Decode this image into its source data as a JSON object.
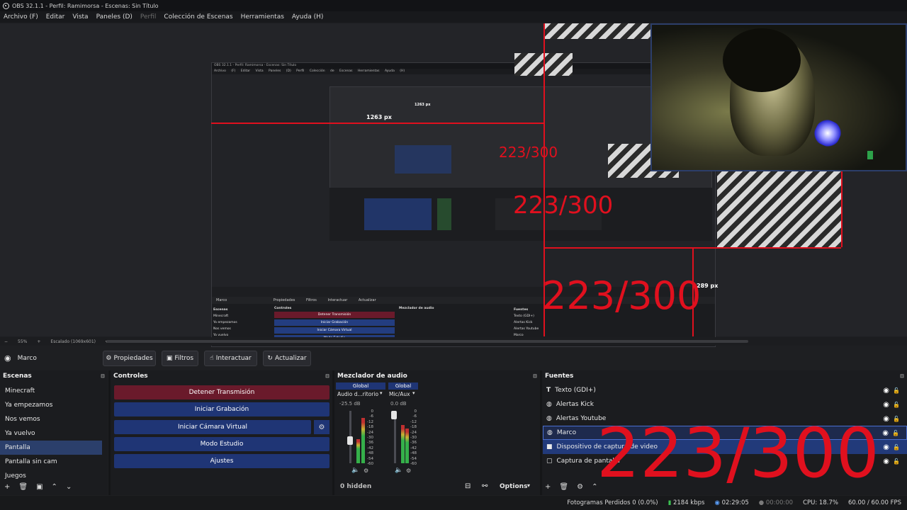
{
  "window": {
    "title": "OBS 32.1.1 - Perfil: Ramimorsa - Escenas: Sin Título"
  },
  "menu": {
    "items": [
      "Archivo (F)",
      "Editar",
      "Vista",
      "Paneles (D)",
      "Perfil",
      "Colección de Escenas",
      "Herramientas",
      "Ayuda (H)"
    ]
  },
  "preview": {
    "nested_title": "OBS 32.1.1 - Perfil: Ramimorsa - Escenas: Sin Título",
    "nested_menu": "Archivo (F) Editar Vista Paneles (D) Perfil Colección de Escenas Herramientas Ayuda (H)",
    "width_label": "1263 px",
    "width_label_small": "1263 px",
    "height_label": "289 px",
    "counter": "223/300",
    "nested_source": "Marco",
    "nested_buttons": [
      "Propiedades",
      "Filtros",
      "Interactuar",
      "Actualizar"
    ],
    "nested_docks": [
      "Escenas",
      "Controles",
      "Mezclador de audio",
      "Fuentes"
    ],
    "nested_status": "Fotogramas Perdidos 0 (0.0%)   2184 kbps   02:29:05   CPU: 18.7%   60.00 / 60.00 FPS"
  },
  "zoombar": {
    "zoom": "55%",
    "scale": "Escalado (1069x601)"
  },
  "context": {
    "source_name": "Marco",
    "buttons": [
      "Propiedades",
      "Filtros",
      "Interactuar",
      "Actualizar"
    ]
  },
  "scenes": {
    "title": "Escenas",
    "items": [
      "Minecraft",
      "Ya empezamos",
      "Nos vemos",
      "Ya vuelvo",
      "Pantalla",
      "Pantalla sin cam",
      "Juegos"
    ],
    "active_index": 4
  },
  "controls": {
    "title": "Controles",
    "buttons": [
      "Detener Transmisión",
      "Iniciar Grabación",
      "Iniciar Cámara Virtual",
      "Modo Estudio",
      "Ajustes"
    ]
  },
  "mixer": {
    "title": "Mezclador de audio",
    "channels": [
      {
        "header": "Global",
        "name": "Audio d...ritorio",
        "db": "-25.5 dB",
        "level": 0.55
      },
      {
        "header": "Global",
        "name": "Mic/Aux",
        "db": "0.0 dB",
        "level": 0.62
      }
    ],
    "scale": [
      "0",
      "-6",
      "-12",
      "-18",
      "-24",
      "-30",
      "-36",
      "-42",
      "-48",
      "-54",
      "-60"
    ],
    "hidden": "0 hidden",
    "options": "Options"
  },
  "sources": {
    "title": "Fuentes",
    "items": [
      {
        "label": "Texto (GDI+)",
        "icon": "text-icon"
      },
      {
        "label": "Alertas Kick",
        "icon": "globe-icon"
      },
      {
        "label": "Alertas Youtube",
        "icon": "globe-icon"
      },
      {
        "label": "Marco",
        "icon": "globe-icon"
      },
      {
        "label": "Dispositivo de captura de video",
        "icon": "camera-icon"
      },
      {
        "label": "Captura de pantalla",
        "icon": "monitor-icon"
      }
    ],
    "selected_index": 3,
    "highlight_index": 4
  },
  "status": {
    "dropped": "Fotogramas Perdidos 0 (0.0%)",
    "bitrate": "2184 kbps",
    "stream_time": "02:29:05",
    "rec_time": "00:00:00",
    "cpu": "CPU: 18.7%",
    "fps": "60.00 / 60.00 FPS"
  },
  "colors": {
    "accent": "#1f3575",
    "stop": "#6a1a2b",
    "red_overlay": "#e0101e"
  }
}
